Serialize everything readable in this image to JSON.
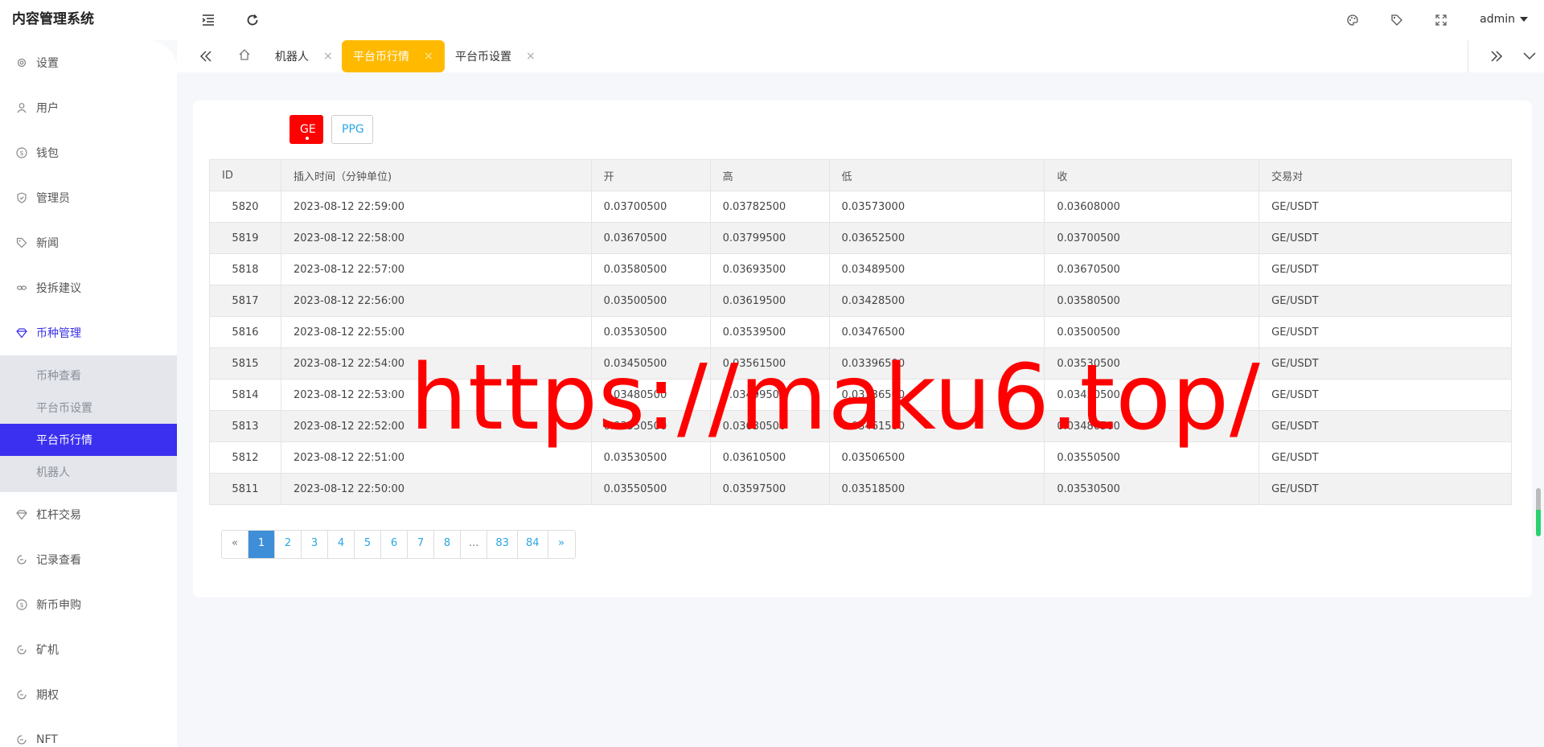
{
  "app": {
    "title": "内容管理系统"
  },
  "sidebar": {
    "items": [
      {
        "label": "设置",
        "icon": "gear-icon"
      },
      {
        "label": "用户",
        "icon": "user-icon"
      },
      {
        "label": "钱包",
        "icon": "dollar-icon"
      },
      {
        "label": "管理员",
        "icon": "shield-icon"
      },
      {
        "label": "新闻",
        "icon": "tag-icon"
      },
      {
        "label": "投拆建议",
        "icon": "link-icon"
      },
      {
        "label": "币种管理",
        "icon": "diamond-icon"
      }
    ],
    "subitems": [
      {
        "label": "币种查看"
      },
      {
        "label": "平台币设置"
      },
      {
        "label": "平台币行情"
      },
      {
        "label": "机器人"
      }
    ],
    "items_after": [
      {
        "label": "杠杆交易",
        "icon": "diamond-icon"
      },
      {
        "label": "记录查看",
        "icon": "circle-arrow-icon"
      },
      {
        "label": "新币申购",
        "icon": "dollar-icon"
      },
      {
        "label": "矿机",
        "icon": "circle-arrow-icon"
      },
      {
        "label": "期权",
        "icon": "circle-arrow-icon"
      },
      {
        "label": "NFT",
        "icon": "circle-arrow-icon"
      }
    ]
  },
  "topbar": {
    "user": "admin"
  },
  "tabs": [
    {
      "label": "机器人"
    },
    {
      "label": "平台币行情"
    },
    {
      "label": "平台币设置"
    }
  ],
  "coins": {
    "ge": "GE",
    "ppg": "PPG"
  },
  "table": {
    "headers": [
      "ID",
      "插入时间（分钟单位)",
      "开",
      "高",
      "低",
      "收",
      "交易对"
    ],
    "rows": [
      [
        "5820",
        "2023-08-12 22:59:00",
        "0.03700500",
        "0.03782500",
        "0.03573000",
        "0.03608000",
        "GE/USDT"
      ],
      [
        "5819",
        "2023-08-12 22:58:00",
        "0.03670500",
        "0.03799500",
        "0.03652500",
        "0.03700500",
        "GE/USDT"
      ],
      [
        "5818",
        "2023-08-12 22:57:00",
        "0.03580500",
        "0.03693500",
        "0.03489500",
        "0.03670500",
        "GE/USDT"
      ],
      [
        "5817",
        "2023-08-12 22:56:00",
        "0.03500500",
        "0.03619500",
        "0.03428500",
        "0.03580500",
        "GE/USDT"
      ],
      [
        "5816",
        "2023-08-12 22:55:00",
        "0.03530500",
        "0.03539500",
        "0.03476500",
        "0.03500500",
        "GE/USDT"
      ],
      [
        "5815",
        "2023-08-12 22:54:00",
        "0.03450500",
        "0.03561500",
        "0.03396500",
        "0.03530500",
        "GE/USDT"
      ],
      [
        "5814",
        "2023-08-12 22:53:00",
        "0.03480500",
        "0.03499500",
        "0.03336500",
        "0.03450500",
        "GE/USDT"
      ],
      [
        "5813",
        "2023-08-12 22:52:00",
        "0.03550500",
        "0.03630500",
        "0.03461500",
        "0.03480500",
        "GE/USDT"
      ],
      [
        "5812",
        "2023-08-12 22:51:00",
        "0.03530500",
        "0.03610500",
        "0.03506500",
        "0.03550500",
        "GE/USDT"
      ],
      [
        "5811",
        "2023-08-12 22:50:00",
        "0.03550500",
        "0.03597500",
        "0.03518500",
        "0.03530500",
        "GE/USDT"
      ]
    ]
  },
  "pagination": {
    "prev": "«",
    "pages": [
      "1",
      "2",
      "3",
      "4",
      "5",
      "6",
      "7",
      "8",
      "...",
      "83",
      "84"
    ],
    "next": "»",
    "current": "1"
  },
  "watermark": "https://maku6.top/"
}
